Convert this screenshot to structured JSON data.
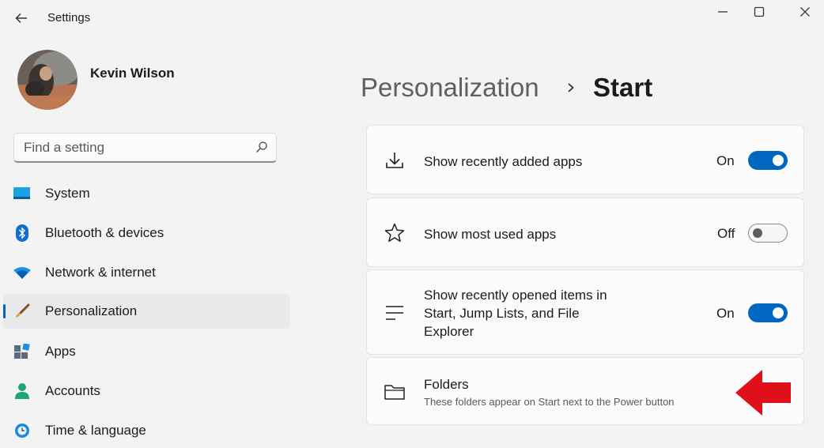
{
  "window": {
    "title": "Settings",
    "controls": {
      "back_icon": "back-arrow-icon",
      "minimize_icon": "minimize-icon",
      "maximize_icon": "maximize-icon",
      "close_icon": "close-icon"
    }
  },
  "profile": {
    "name": "Kevin Wilson"
  },
  "search": {
    "placeholder": "Find a setting",
    "icon": "search-icon"
  },
  "sidebar": {
    "items": [
      {
        "label": "System",
        "icon": "system-icon",
        "selected": false
      },
      {
        "label": "Bluetooth & devices",
        "icon": "bluetooth-icon",
        "selected": false
      },
      {
        "label": "Network & internet",
        "icon": "wifi-icon",
        "selected": false
      },
      {
        "label": "Personalization",
        "icon": "paintbrush-icon",
        "selected": true
      },
      {
        "label": "Apps",
        "icon": "apps-icon",
        "selected": false
      },
      {
        "label": "Accounts",
        "icon": "accounts-icon",
        "selected": false
      },
      {
        "label": "Time & language",
        "icon": "globe-clock-icon",
        "selected": false
      }
    ]
  },
  "breadcrumb": {
    "parent": "Personalization",
    "separator_icon": "chevron-right-icon",
    "current": "Start"
  },
  "settings": [
    {
      "label": "Show recently added apps",
      "icon": "download-icon",
      "state": "On",
      "on": true
    },
    {
      "label": "Show most used apps",
      "icon": "star-icon",
      "state": "Off",
      "on": false
    },
    {
      "label_lines": [
        "Show recently opened items in",
        "Start, Jump Lists, and File",
        "Explorer"
      ],
      "icon": "list-icon",
      "state": "On",
      "on": true
    },
    {
      "label": "Folders",
      "description": "These folders appear on Start next to the Power button",
      "icon": "folder-icon"
    }
  ],
  "annotation": {
    "icon": "red-arrow-icon"
  },
  "colors": {
    "accent": "#0067c0",
    "annotation": "#e0101b"
  }
}
